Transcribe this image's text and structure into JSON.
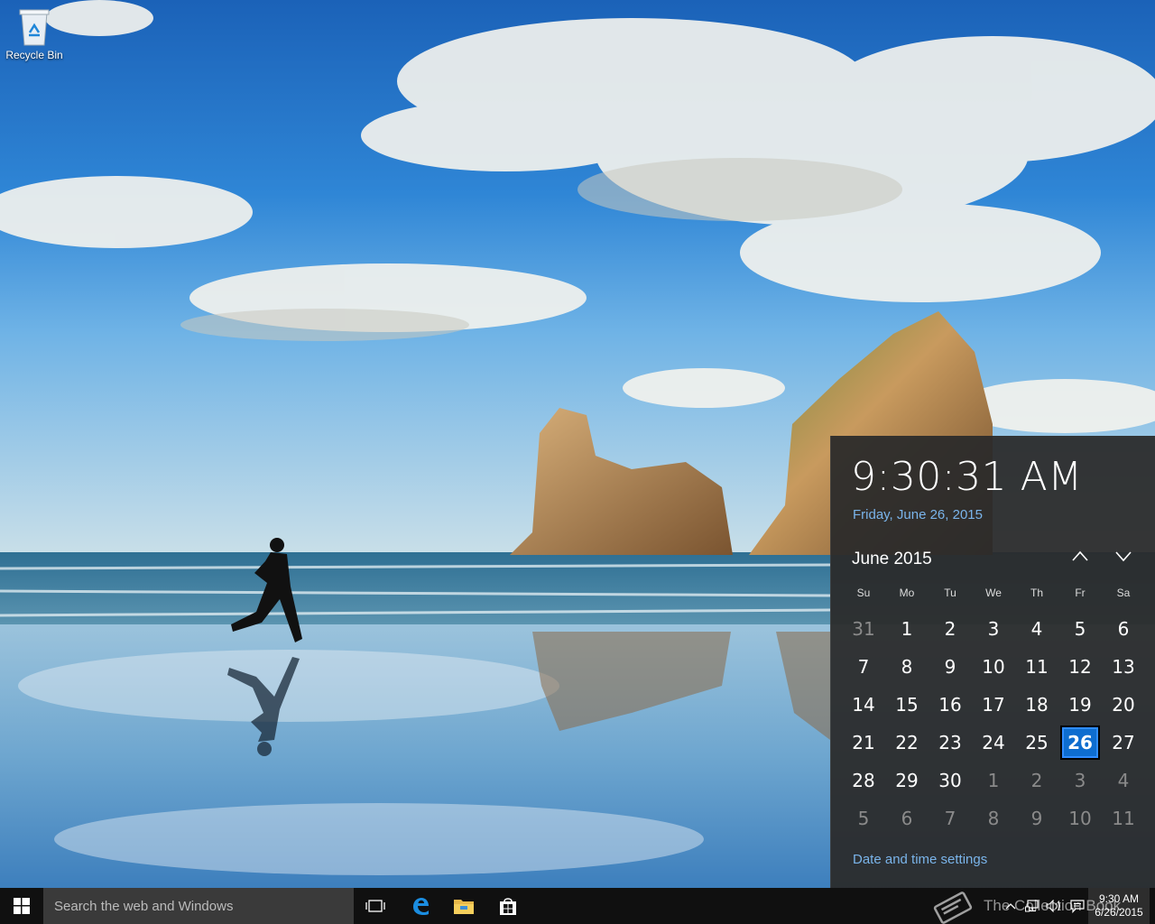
{
  "desktop": {
    "icons": [
      {
        "label": "Recycle Bin",
        "icon": "recycle-bin-icon"
      }
    ]
  },
  "flyout": {
    "time": "9:30:31 AM",
    "date_long": "Friday, June 26, 2015",
    "month_label": "June 2015",
    "nav_up": "chevron-up-icon",
    "nav_down": "chevron-down-icon",
    "weekdays": [
      "Su",
      "Mo",
      "Tu",
      "We",
      "Th",
      "Fr",
      "Sa"
    ],
    "days": [
      {
        "n": "31",
        "other": true
      },
      {
        "n": "1"
      },
      {
        "n": "2"
      },
      {
        "n": "3"
      },
      {
        "n": "4"
      },
      {
        "n": "5"
      },
      {
        "n": "6"
      },
      {
        "n": "7"
      },
      {
        "n": "8"
      },
      {
        "n": "9"
      },
      {
        "n": "10"
      },
      {
        "n": "11"
      },
      {
        "n": "12"
      },
      {
        "n": "13"
      },
      {
        "n": "14"
      },
      {
        "n": "15"
      },
      {
        "n": "16"
      },
      {
        "n": "17"
      },
      {
        "n": "18"
      },
      {
        "n": "19"
      },
      {
        "n": "20"
      },
      {
        "n": "21"
      },
      {
        "n": "22"
      },
      {
        "n": "23"
      },
      {
        "n": "24"
      },
      {
        "n": "25"
      },
      {
        "n": "26",
        "today": true
      },
      {
        "n": "27"
      },
      {
        "n": "28"
      },
      {
        "n": "29"
      },
      {
        "n": "30"
      },
      {
        "n": "1",
        "other": true
      },
      {
        "n": "2",
        "other": true
      },
      {
        "n": "3",
        "other": true
      },
      {
        "n": "4",
        "other": true
      },
      {
        "n": "5",
        "other": true
      },
      {
        "n": "6",
        "other": true
      },
      {
        "n": "7",
        "other": true
      },
      {
        "n": "8",
        "other": true
      },
      {
        "n": "9",
        "other": true
      },
      {
        "n": "10",
        "other": true
      },
      {
        "n": "11",
        "other": true
      }
    ],
    "settings_link": "Date and time settings",
    "accent_color": "#0e6dcf",
    "link_color": "#7ab4ea"
  },
  "taskbar": {
    "search_placeholder": "Search the web and Windows",
    "pinned": [
      "task-view-icon",
      "edge-icon",
      "file-explorer-icon",
      "store-icon"
    ],
    "watermark": "The Collection Book",
    "tray": {
      "icons": [
        "chevron-up-icon",
        "network-icon",
        "volume-icon",
        "action-center-icon"
      ],
      "time": "9:30 AM",
      "date": "6/26/2015"
    }
  }
}
